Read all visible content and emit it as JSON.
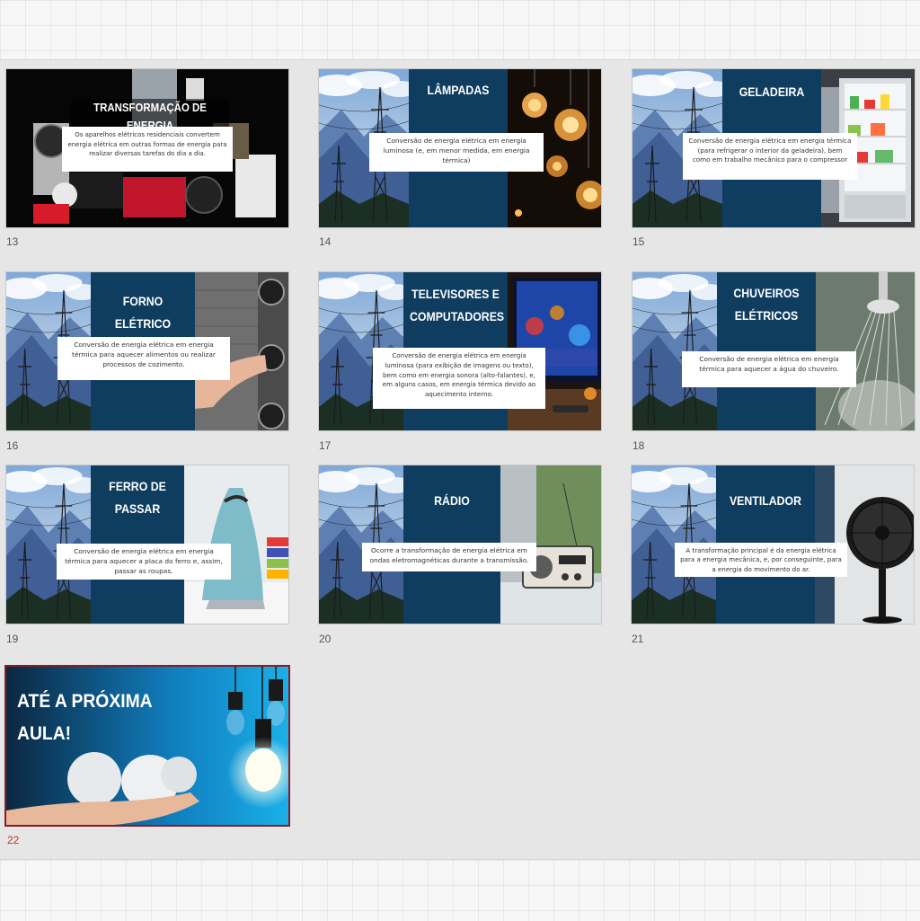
{
  "slides": [
    {
      "number": "13",
      "title": "TRANSFORMAÇÃO DE ENERGIA",
      "body": "Os aparelhos elétricos residenciais convertem energia elétrica em outras formas de energia para realizar diversas tarefas do dia a dia."
    },
    {
      "number": "14",
      "title": "LÂMPADAS",
      "body": "Conversão de energia elétrica em energia luminosa (e, em menor medida, em energia térmica)"
    },
    {
      "number": "15",
      "title": "GELADEIRA",
      "body": "Conversão de energia elétrica em energia térmica (para refrigerar o interior da geladeira), bem como em trabalho mecânico para o compressor"
    },
    {
      "number": "16",
      "title": "FORNO ELÉTRICO",
      "body": "Conversão de energia elétrica em energia térmica para aquecer alimentos ou realizar processos de cozimento."
    },
    {
      "number": "17",
      "title_line1": "TELEVISORES E",
      "title_line2": "COMPUTADORES",
      "body": "Conversão de energia elétrica em energia luminosa (para exibição de imagens ou texto), bem como em energia sonora (alto-falantes), e, em alguns casos, em energia térmica devido ao aquecimento interno."
    },
    {
      "number": "18",
      "title_line1": "CHUVEIROS",
      "title_line2": "ELÉTRICOS",
      "body": "Conversão de energia elétrica em energia térmica para aquecer a água do chuveiro."
    },
    {
      "number": "19",
      "title_line1": "FERRO DE",
      "title_line2": "PASSAR",
      "body": "Conversão de energia elétrica em energia térmica para aquecer a placa do ferro e, assim, passar as roupas."
    },
    {
      "number": "20",
      "title": "RÁDIO",
      "body": "Ocorre a transformação de energia elétrica em ondas eletromagnéticas durante a transmissão."
    },
    {
      "number": "21",
      "title": "VENTILADOR",
      "body": "A transformação principal é da energia elétrica para a energia mecânica, e, por conseguinte, para a energia do movimento do ar."
    },
    {
      "number": "22",
      "title_line1": "ATÉ A PRÓXIMA",
      "title_line2": "AULA!"
    }
  ],
  "colors": {
    "panel": "#0f3d5f",
    "selected_border": "#8b1a26",
    "selected_number": "#c0392b"
  }
}
